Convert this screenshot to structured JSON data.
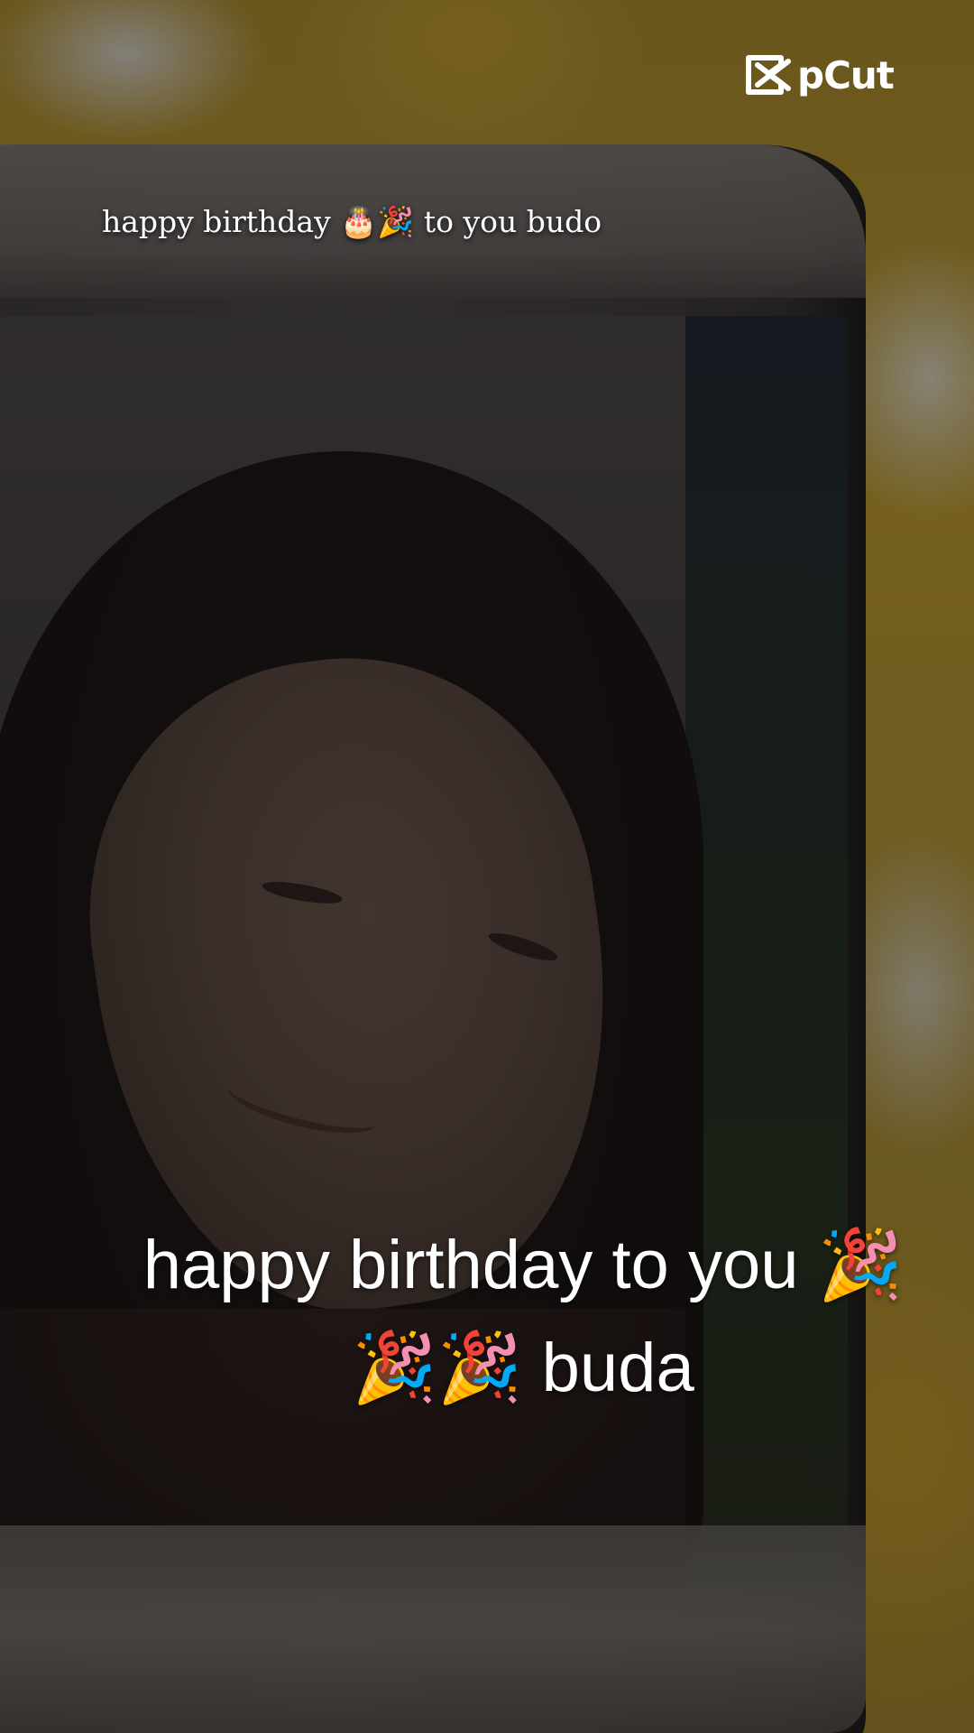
{
  "logo": {
    "text": "pCut",
    "icon": "capcut-logo-icon"
  },
  "captions": {
    "small": "happy birthday 🎂🎉 to you budo",
    "big_line1": "happy birthday to you 🎉",
    "big_line2": "🎉🎉 buda"
  }
}
